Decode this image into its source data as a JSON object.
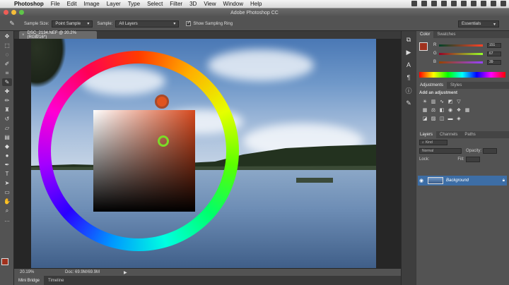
{
  "menubar": {
    "app": "Photoshop",
    "items": [
      "File",
      "Edit",
      "Image",
      "Layer",
      "Type",
      "Select",
      "Filter",
      "3D",
      "View",
      "Window",
      "Help"
    ]
  },
  "titlebar": {
    "title": "Adobe Photoshop CC"
  },
  "options": {
    "sample_size_label": "Sample Size:",
    "sample_size_value": "Point Sample",
    "sample_label": "Sample:",
    "sample_value": "All Layers",
    "show_ring_label": "Show Sampling Ring",
    "workspace": "Essentials"
  },
  "document": {
    "tab_label": "DSC_2134.NEF @ 20.2% (RGB/16*)"
  },
  "status": {
    "zoom": "20.19%",
    "doc_info": "Doc: 69.9M/69.9M"
  },
  "bottom_tabs": [
    "Mini Bridge",
    "Timeline"
  ],
  "color_panel": {
    "tabs": [
      "Color",
      "Swatches"
    ],
    "channels": [
      {
        "name": "R",
        "value": "151"
      },
      {
        "name": "G",
        "value": "67"
      },
      {
        "name": "B",
        "value": "39"
      }
    ],
    "foreground": "#a0311d"
  },
  "adjustments_panel": {
    "tabs": [
      "Adjustments",
      "Styles"
    ],
    "title": "Add an adjustment"
  },
  "layers_panel": {
    "tabs": [
      "Layers",
      "Channels",
      "Paths"
    ],
    "kind_label": "Kind",
    "blend_mode": "Normal",
    "opacity_label": "Opacity:",
    "lock_label": "Lock:",
    "fill_label": "Fill:",
    "layer_name": "Background"
  },
  "colors": {
    "accent_selected": "#3d6ea6",
    "wheel_handle": "#e0541f",
    "picker_ring": "#7cdb28"
  }
}
